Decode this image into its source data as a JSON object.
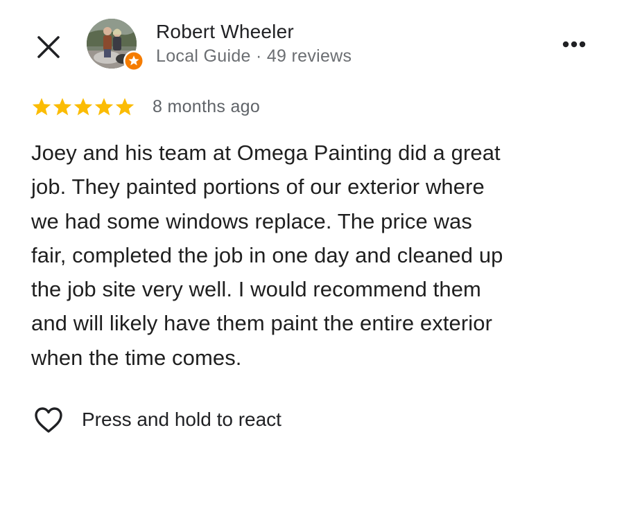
{
  "header": {
    "close_icon": "close-icon",
    "reviewer_name": "Robert Wheeler",
    "reviewer_meta": "Local Guide · 49 reviews",
    "badge_icon": "local-guide-star-badge",
    "more_icon": "more-horizontal-icon"
  },
  "review": {
    "rating": 5,
    "rating_max": 5,
    "star_color": "#fbbc04",
    "time_ago": "8 months ago",
    "text": "Joey and his team at Omega Painting did a great\njob.  They painted portions of our exterior where\nwe had some windows replace.  The price was\nfair, completed the job in one day and cleaned up\nthe job site very well.  I would recommend them\nand will likely have them paint the entire exterior\nwhen the time comes."
  },
  "reactions": {
    "icon": "heart-outline-icon",
    "label": "Press and hold to react"
  },
  "colors": {
    "badge_orange": "#f57c00",
    "text_primary": "#1f1f1f",
    "text_secondary": "#6b6e72"
  }
}
